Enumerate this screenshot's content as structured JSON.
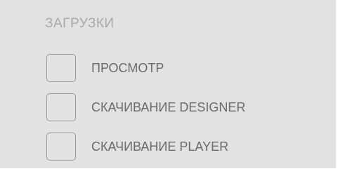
{
  "section": {
    "title": "ЗАГРУЗКИ"
  },
  "options": [
    {
      "label": "ПРОСМОТР",
      "checked": false
    },
    {
      "label": "СКАЧИВАНИЕ DESIGNER",
      "checked": false
    },
    {
      "label": "СКАЧИВАНИЕ PLAYER",
      "checked": false
    }
  ],
  "colors": {
    "panel_background": "#e2e2e2",
    "title_text": "#a9a9a9",
    "label_text": "#6b6b6b",
    "checkbox_border": "#9a9a9a"
  }
}
